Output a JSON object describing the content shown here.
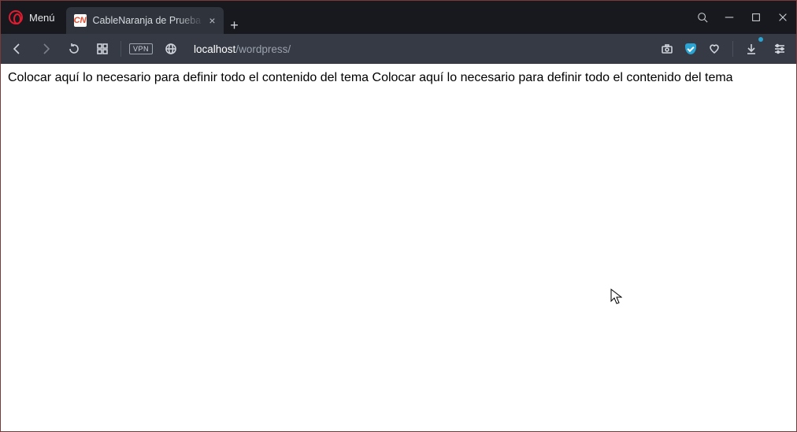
{
  "menu": {
    "label": "Menú"
  },
  "tab": {
    "favicon_letters": "CN",
    "title": "CableNaranja de Prueba - C"
  },
  "address": {
    "host": "localhost",
    "path": "/wordpress/"
  },
  "vpn_label": "VPN",
  "page": {
    "body_text": "Colocar aquí lo necesario para definir todo el contenido del tema Colocar aquí lo necesario para definir todo el contenido del tema"
  }
}
